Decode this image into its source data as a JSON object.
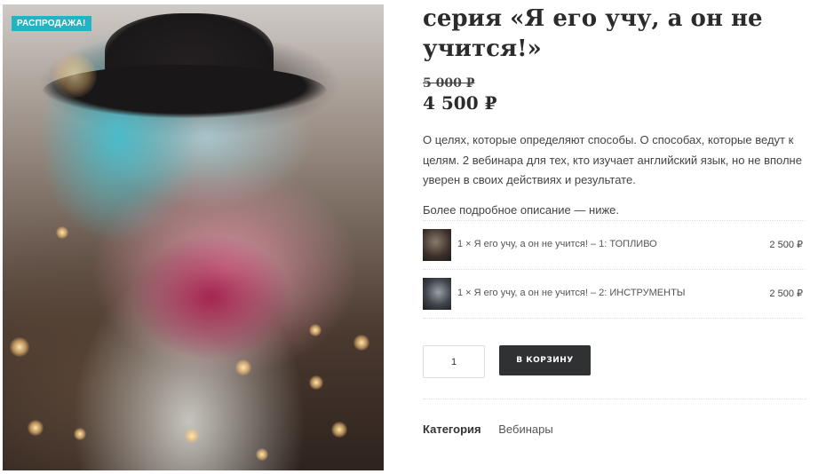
{
  "product": {
    "badge": "РАСПРОДАЖА!",
    "title": "серия «Я его учу, а он не учится!»",
    "price_old": "5 000 ₽",
    "price_new": "4 500 ₽",
    "description": "О целях, которые определяют способы. О способах, которые ведут к целям. 2 вебинара для тех, кто изучает английский язык, но не вполне уверен в своих действиях и результате.",
    "more_text": "Более подробное описание — ниже.",
    "bundle": [
      {
        "label": "1 × Я его учу, а он не учится! – 1: ТОПЛИВО",
        "price": "2 500 ₽"
      },
      {
        "label": "1 × Я его учу, а он не учится! – 2: ИНСТРУМЕНТЫ",
        "price": "2 500 ₽"
      }
    ],
    "quantity": "1",
    "add_to_cart": "В КОРЗИНУ",
    "category_label": "Категория",
    "category_value": "Вебинары"
  },
  "colors": {
    "badge_bg": "#1fb5c6",
    "button_bg": "#2f3133"
  }
}
